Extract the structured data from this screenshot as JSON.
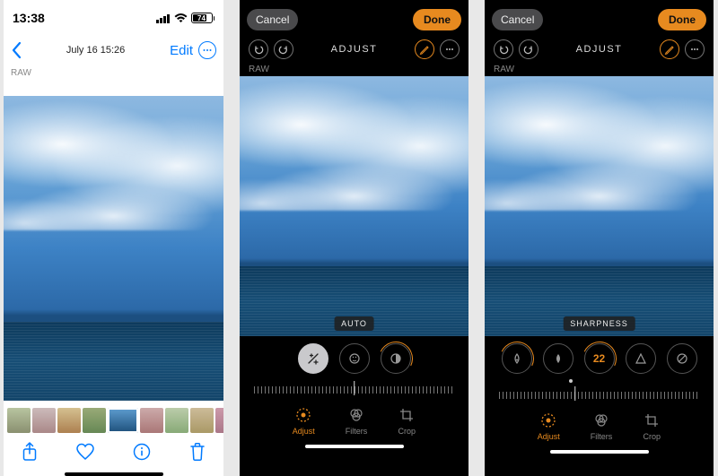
{
  "screenA": {
    "time": "13:38",
    "battery": "74",
    "date": "July 16  15:26",
    "edit": "Edit",
    "raw": "RAW",
    "toolbar": {
      "share": "share",
      "favorite": "favorite",
      "info": "info",
      "delete": "delete"
    }
  },
  "screenB": {
    "cancel": "Cancel",
    "done": "Done",
    "mode": "ADJUST",
    "raw": "RAW",
    "badge": "AUTO",
    "tabs": {
      "adjust": "Adjust",
      "filters": "Filters",
      "crop": "Crop"
    }
  },
  "screenC": {
    "cancel": "Cancel",
    "done": "Done",
    "mode": "ADJUST",
    "raw": "RAW",
    "badge": "SHARPNESS",
    "value": "22",
    "tabs": {
      "adjust": "Adjust",
      "filters": "Filters",
      "crop": "Crop"
    }
  }
}
